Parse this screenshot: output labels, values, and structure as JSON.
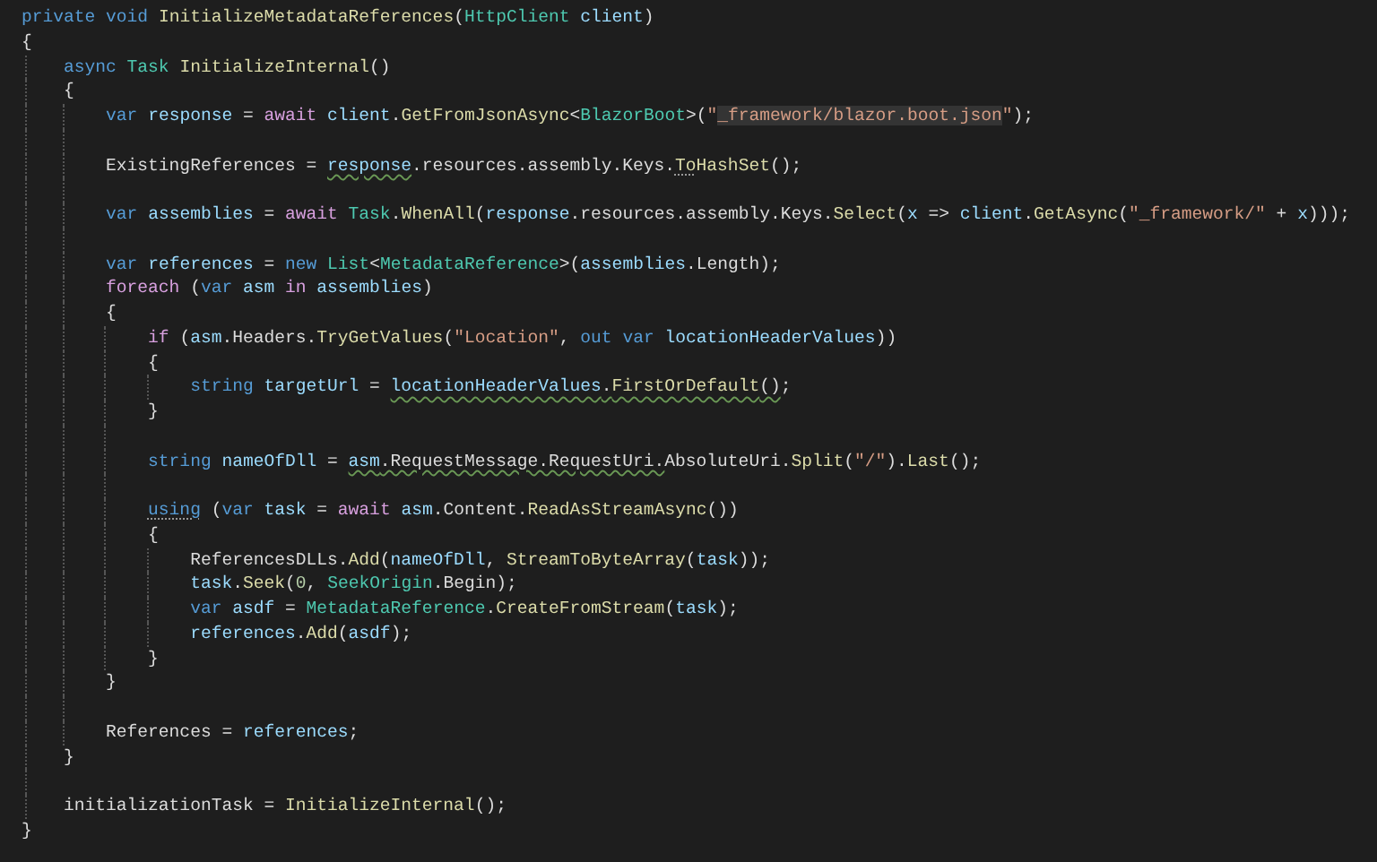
{
  "editor": {
    "lines": [
      {
        "kind": "code",
        "tokens": [
          {
            "kind": "kw",
            "text": "private "
          },
          {
            "kind": "kw",
            "text": "void "
          },
          {
            "kind": "m",
            "text": "InitializeMetadataReferences"
          },
          {
            "kind": "p",
            "text": "("
          },
          {
            "kind": "ty",
            "text": "HttpClient "
          },
          {
            "kind": "loc",
            "text": "client"
          },
          {
            "kind": "p",
            "text": ")"
          }
        ]
      },
      {
        "kind": "code",
        "tokens": [
          {
            "kind": "p",
            "text": "{"
          }
        ],
        "children": [
          {
            "kind": "code",
            "tokens": [
              {
                "kind": "kw",
                "text": "async "
              },
              {
                "kind": "ty",
                "text": "Task "
              },
              {
                "kind": "m",
                "text": "InitializeInternal"
              },
              {
                "kind": "p",
                "text": "()"
              }
            ]
          },
          {
            "kind": "code",
            "tokens": [
              {
                "kind": "p",
                "text": "{"
              }
            ],
            "children": [
              {
                "kind": "code",
                "tokens": [
                  {
                    "kind": "kw",
                    "text": "var "
                  },
                  {
                    "kind": "loc",
                    "text": "response"
                  },
                  {
                    "kind": "p",
                    "text": " = "
                  },
                  {
                    "kind": "ctl",
                    "text": "await "
                  },
                  {
                    "kind": "loc",
                    "text": "client"
                  },
                  {
                    "kind": "p",
                    "text": "."
                  },
                  {
                    "kind": "m",
                    "text": "GetFromJsonAsync"
                  },
                  {
                    "kind": "p",
                    "text": "<"
                  },
                  {
                    "kind": "ty",
                    "text": "BlazorBoot"
                  },
                  {
                    "kind": "p",
                    "text": ">("
                  },
                  {
                    "kind": "s",
                    "text": "\""
                  },
                  {
                    "kind": "s",
                    "text": "_framework/blazor.boot.json",
                    "highlighted": true
                  },
                  {
                    "kind": "s",
                    "text": "\""
                  },
                  {
                    "kind": "p",
                    "text": ");"
                  }
                ]
              },
              {
                "kind": "blank"
              },
              {
                "kind": "code",
                "tokens": [
                  {
                    "kind": "p",
                    "text": "ExistingReferences = "
                  },
                  {
                    "kind": "loc",
                    "text": "response",
                    "squiggle": true
                  },
                  {
                    "kind": "p",
                    "text": ".resources.assembly.Keys."
                  },
                  {
                    "kind": "m",
                    "text": "To",
                    "dotted": true
                  },
                  {
                    "kind": "m",
                    "text": "HashSet"
                  },
                  {
                    "kind": "p",
                    "text": "();"
                  }
                ]
              },
              {
                "kind": "blank"
              },
              {
                "kind": "code",
                "tokens": [
                  {
                    "kind": "kw",
                    "text": "var "
                  },
                  {
                    "kind": "loc",
                    "text": "assemblies"
                  },
                  {
                    "kind": "p",
                    "text": " = "
                  },
                  {
                    "kind": "ctl",
                    "text": "await "
                  },
                  {
                    "kind": "ty",
                    "text": "Task"
                  },
                  {
                    "kind": "p",
                    "text": "."
                  },
                  {
                    "kind": "m",
                    "text": "WhenAll"
                  },
                  {
                    "kind": "p",
                    "text": "("
                  },
                  {
                    "kind": "loc",
                    "text": "response"
                  },
                  {
                    "kind": "p",
                    "text": ".resources.assembly.Keys."
                  },
                  {
                    "kind": "m",
                    "text": "Select"
                  },
                  {
                    "kind": "p",
                    "text": "("
                  },
                  {
                    "kind": "loc",
                    "text": "x"
                  },
                  {
                    "kind": "p",
                    "text": " => "
                  },
                  {
                    "kind": "loc",
                    "text": "client"
                  },
                  {
                    "kind": "p",
                    "text": "."
                  },
                  {
                    "kind": "m",
                    "text": "GetAsync"
                  },
                  {
                    "kind": "p",
                    "text": "("
                  },
                  {
                    "kind": "s",
                    "text": "\"_framework/\""
                  },
                  {
                    "kind": "p",
                    "text": " + "
                  },
                  {
                    "kind": "loc",
                    "text": "x"
                  },
                  {
                    "kind": "p",
                    "text": ")));"
                  }
                ]
              },
              {
                "kind": "blank"
              },
              {
                "kind": "code",
                "tokens": [
                  {
                    "kind": "kw",
                    "text": "var "
                  },
                  {
                    "kind": "loc",
                    "text": "references"
                  },
                  {
                    "kind": "p",
                    "text": " = "
                  },
                  {
                    "kind": "kw",
                    "text": "new "
                  },
                  {
                    "kind": "ty",
                    "text": "List"
                  },
                  {
                    "kind": "p",
                    "text": "<"
                  },
                  {
                    "kind": "ty",
                    "text": "MetadataReference"
                  },
                  {
                    "kind": "p",
                    "text": ">("
                  },
                  {
                    "kind": "loc",
                    "text": "assemblies"
                  },
                  {
                    "kind": "p",
                    "text": ".Length);"
                  }
                ]
              },
              {
                "kind": "code",
                "tokens": [
                  {
                    "kind": "ctl",
                    "text": "foreach"
                  },
                  {
                    "kind": "p",
                    "text": " ("
                  },
                  {
                    "kind": "kw",
                    "text": "var "
                  },
                  {
                    "kind": "loc",
                    "text": "asm "
                  },
                  {
                    "kind": "ctl",
                    "text": "in "
                  },
                  {
                    "kind": "loc",
                    "text": "assemblies"
                  },
                  {
                    "kind": "p",
                    "text": ")"
                  }
                ]
              },
              {
                "kind": "code",
                "tokens": [
                  {
                    "kind": "p",
                    "text": "{"
                  }
                ],
                "children": [
                  {
                    "kind": "code",
                    "tokens": [
                      {
                        "kind": "ctl",
                        "text": "if"
                      },
                      {
                        "kind": "p",
                        "text": " ("
                      },
                      {
                        "kind": "loc",
                        "text": "asm"
                      },
                      {
                        "kind": "p",
                        "text": ".Headers."
                      },
                      {
                        "kind": "m",
                        "text": "TryGetValues"
                      },
                      {
                        "kind": "p",
                        "text": "("
                      },
                      {
                        "kind": "s",
                        "text": "\"Location\""
                      },
                      {
                        "kind": "p",
                        "text": ", "
                      },
                      {
                        "kind": "kw",
                        "text": "out "
                      },
                      {
                        "kind": "kw",
                        "text": "var "
                      },
                      {
                        "kind": "loc",
                        "text": "locationHeaderValues"
                      },
                      {
                        "kind": "p",
                        "text": "))"
                      }
                    ]
                  },
                  {
                    "kind": "code",
                    "tokens": [
                      {
                        "kind": "p",
                        "text": "{"
                      }
                    ],
                    "children": [
                      {
                        "kind": "code",
                        "tokens": [
                          {
                            "kind": "kw",
                            "text": "string "
                          },
                          {
                            "kind": "loc",
                            "text": "targetUrl"
                          },
                          {
                            "kind": "p",
                            "text": " = "
                          },
                          {
                            "kind": "loc",
                            "text": "locationHeaderValues",
                            "squiggle": true
                          },
                          {
                            "kind": "p",
                            "text": ".",
                            "squiggle": true
                          },
                          {
                            "kind": "m",
                            "text": "FirstOrDefault",
                            "squiggle": true
                          },
                          {
                            "kind": "p",
                            "text": "()",
                            "squiggle": true
                          },
                          {
                            "kind": "p",
                            "text": ";"
                          }
                        ]
                      }
                    ]
                  },
                  {
                    "kind": "code",
                    "tokens": [
                      {
                        "kind": "p",
                        "text": "}"
                      }
                    ]
                  },
                  {
                    "kind": "blank"
                  },
                  {
                    "kind": "code",
                    "tokens": [
                      {
                        "kind": "kw",
                        "text": "string "
                      },
                      {
                        "kind": "loc",
                        "text": "nameOfDll"
                      },
                      {
                        "kind": "p",
                        "text": " = "
                      },
                      {
                        "kind": "loc",
                        "text": "asm",
                        "squiggle": true
                      },
                      {
                        "kind": "p",
                        "text": ".RequestMessage.RequestUri.",
                        "squiggle": true
                      },
                      {
                        "kind": "p",
                        "text": "AbsoluteUri."
                      },
                      {
                        "kind": "m",
                        "text": "Split"
                      },
                      {
                        "kind": "p",
                        "text": "("
                      },
                      {
                        "kind": "s",
                        "text": "\"/\""
                      },
                      {
                        "kind": "p",
                        "text": ")."
                      },
                      {
                        "kind": "m",
                        "text": "Last"
                      },
                      {
                        "kind": "p",
                        "text": "();"
                      }
                    ]
                  },
                  {
                    "kind": "blank"
                  },
                  {
                    "kind": "code",
                    "tokens": [
                      {
                        "kind": "kw",
                        "text": "using",
                        "dotted": true
                      },
                      {
                        "kind": "p",
                        "text": " ("
                      },
                      {
                        "kind": "kw",
                        "text": "var "
                      },
                      {
                        "kind": "loc",
                        "text": "task"
                      },
                      {
                        "kind": "p",
                        "text": " = "
                      },
                      {
                        "kind": "ctl",
                        "text": "await "
                      },
                      {
                        "kind": "loc",
                        "text": "asm"
                      },
                      {
                        "kind": "p",
                        "text": ".Content."
                      },
                      {
                        "kind": "m",
                        "text": "ReadAsStreamAsync"
                      },
                      {
                        "kind": "p",
                        "text": "())"
                      }
                    ]
                  },
                  {
                    "kind": "code",
                    "tokens": [
                      {
                        "kind": "p",
                        "text": "{"
                      }
                    ],
                    "children": [
                      {
                        "kind": "code",
                        "tokens": [
                          {
                            "kind": "p",
                            "text": "ReferencesDLLs."
                          },
                          {
                            "kind": "m",
                            "text": "Add"
                          },
                          {
                            "kind": "p",
                            "text": "("
                          },
                          {
                            "kind": "loc",
                            "text": "nameOfDll"
                          },
                          {
                            "kind": "p",
                            "text": ", "
                          },
                          {
                            "kind": "m",
                            "text": "StreamToByteArray"
                          },
                          {
                            "kind": "p",
                            "text": "("
                          },
                          {
                            "kind": "loc",
                            "text": "task"
                          },
                          {
                            "kind": "p",
                            "text": "));"
                          }
                        ]
                      },
                      {
                        "kind": "code",
                        "tokens": [
                          {
                            "kind": "loc",
                            "text": "task"
                          },
                          {
                            "kind": "p",
                            "text": "."
                          },
                          {
                            "kind": "m",
                            "text": "Seek"
                          },
                          {
                            "kind": "p",
                            "text": "("
                          },
                          {
                            "kind": "n",
                            "text": "0"
                          },
                          {
                            "kind": "p",
                            "text": ", "
                          },
                          {
                            "kind": "ty",
                            "text": "SeekOrigin"
                          },
                          {
                            "kind": "p",
                            "text": ".Begin);"
                          }
                        ]
                      },
                      {
                        "kind": "code",
                        "tokens": [
                          {
                            "kind": "kw",
                            "text": "var "
                          },
                          {
                            "kind": "loc",
                            "text": "asdf"
                          },
                          {
                            "kind": "p",
                            "text": " = "
                          },
                          {
                            "kind": "ty",
                            "text": "MetadataReference"
                          },
                          {
                            "kind": "p",
                            "text": "."
                          },
                          {
                            "kind": "m",
                            "text": "CreateFromStream"
                          },
                          {
                            "kind": "p",
                            "text": "("
                          },
                          {
                            "kind": "loc",
                            "text": "task"
                          },
                          {
                            "kind": "p",
                            "text": ");"
                          }
                        ]
                      },
                      {
                        "kind": "code",
                        "tokens": [
                          {
                            "kind": "loc",
                            "text": "references"
                          },
                          {
                            "kind": "p",
                            "text": "."
                          },
                          {
                            "kind": "m",
                            "text": "Add"
                          },
                          {
                            "kind": "p",
                            "text": "("
                          },
                          {
                            "kind": "loc",
                            "text": "asdf"
                          },
                          {
                            "kind": "p",
                            "text": ");"
                          }
                        ]
                      }
                    ]
                  },
                  {
                    "kind": "code",
                    "tokens": [
                      {
                        "kind": "p",
                        "text": "}"
                      }
                    ]
                  }
                ]
              },
              {
                "kind": "code",
                "tokens": [
                  {
                    "kind": "p",
                    "text": "}"
                  }
                ]
              },
              {
                "kind": "blank"
              },
              {
                "kind": "code",
                "tokens": [
                  {
                    "kind": "p",
                    "text": "References = "
                  },
                  {
                    "kind": "loc",
                    "text": "references"
                  },
                  {
                    "kind": "p",
                    "text": ";"
                  }
                ]
              }
            ]
          },
          {
            "kind": "code",
            "tokens": [
              {
                "kind": "p",
                "text": "}"
              }
            ]
          },
          {
            "kind": "blank"
          },
          {
            "kind": "code",
            "tokens": [
              {
                "kind": "p",
                "text": "initializationTask = "
              },
              {
                "kind": "m",
                "text": "InitializeInternal"
              },
              {
                "kind": "p",
                "text": "();"
              }
            ]
          }
        ]
      },
      {
        "kind": "code",
        "tokens": [
          {
            "kind": "p",
            "text": "}"
          }
        ]
      }
    ]
  }
}
